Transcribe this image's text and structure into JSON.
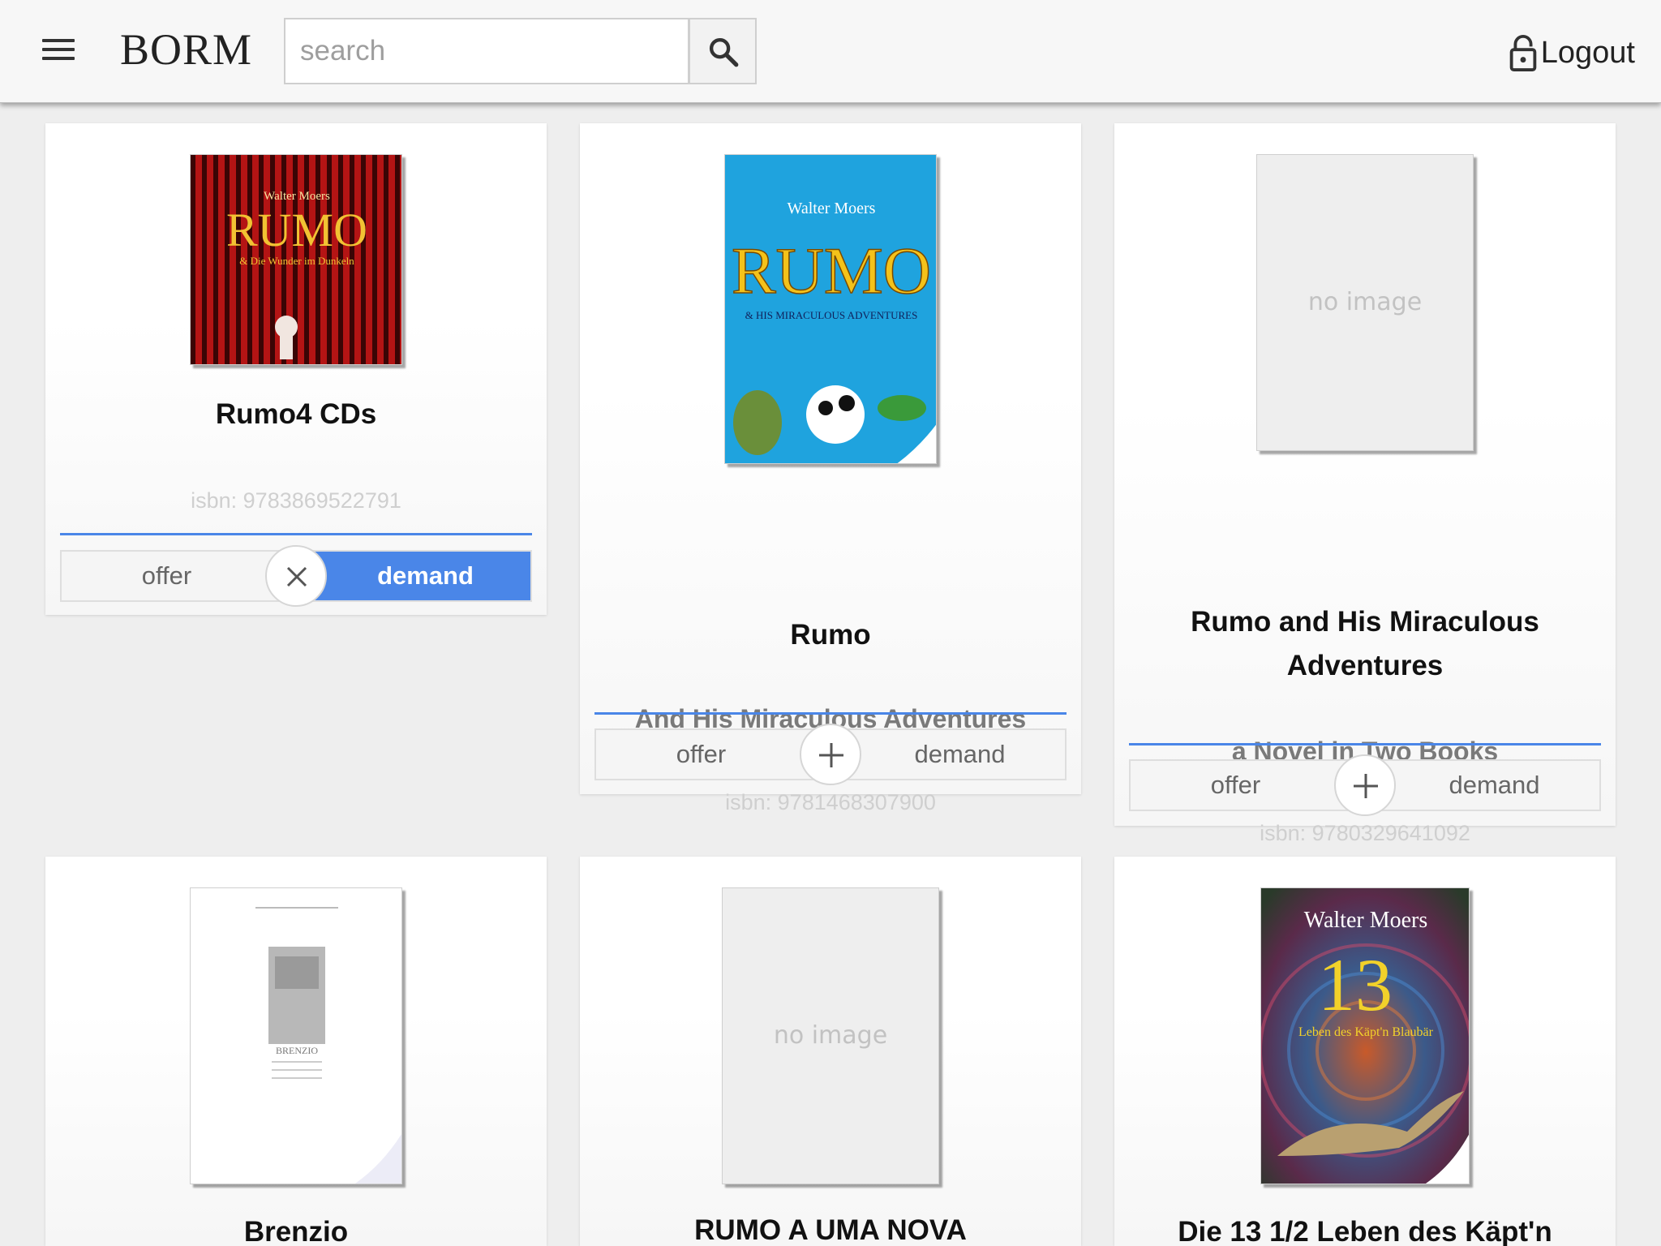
{
  "header": {
    "brand": "BORM",
    "search_placeholder": "search",
    "logout_label": "Logout"
  },
  "toggle_labels": {
    "offer": "offer",
    "demand": "demand"
  },
  "books": [
    {
      "title": "Rumo4 CDs",
      "subtitle": "",
      "isbn": "isbn: 9783869522791",
      "state": "demand"
    },
    {
      "title": "Rumo",
      "subtitle": "And His Miraculous Adventures",
      "isbn": "isbn: 9781468307900",
      "state": "none"
    },
    {
      "title": "Rumo and His Miraculous Adventures",
      "subtitle": "a Novel in Two Books",
      "isbn": "isbn: 9780329641092",
      "state": "none",
      "cover_text": "no image"
    },
    {
      "title": "Brenzio"
    },
    {
      "title": "RUMO A UMA NOVA",
      "cover_text": "no image"
    },
    {
      "title": "Die 13 1/2 Leben des Käpt'n"
    }
  ],
  "covers": {
    "rumo_cd": {
      "author": "Walter Moers",
      "title": "RUMO",
      "subtitle": "& Die Wunder im Dunkeln",
      "colors": [
        "#b01818",
        "#6b0a0a",
        "#f2c233"
      ]
    },
    "rumo_blue": {
      "author": "Walter Moers",
      "title": "RUMO",
      "subtitle": "& HIS MIRACULOUS ADVENTURES",
      "colors": [
        "#1ea0dc",
        "#f4c21a"
      ]
    },
    "brenzio": {
      "title": "BRENZIO"
    },
    "die13": {
      "author": "Walter Moers",
      "title": "13",
      "subtitle": "Leben des Käpt'n Blaubär",
      "colors": [
        "#3a2a2a",
        "#f2d12a"
      ]
    }
  }
}
